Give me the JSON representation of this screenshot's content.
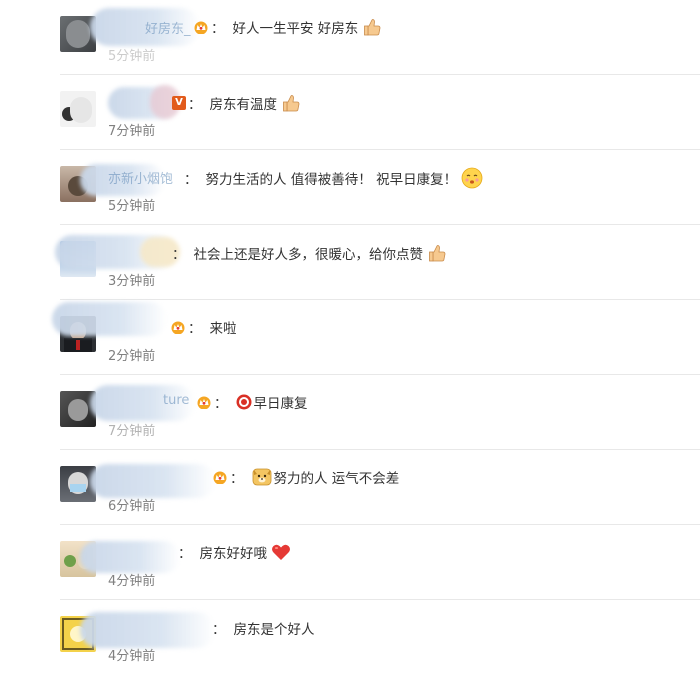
{
  "comments": [
    {
      "name_peek": "好房东_",
      "text": "好人一生平安 好房东",
      "time": "5分钟前",
      "emoji": "thumbs-up-icon",
      "crown": true
    },
    {
      "name_peek": "",
      "text": "房东有温度",
      "time": "7分钟前",
      "emoji": "thumbs-up-icon",
      "crown": false,
      "v_badge": "V"
    },
    {
      "name_peek": "亦新小烟饱",
      "text": "努力生活的人 值得被善待！ 祝早日康复！",
      "time": "5分钟前",
      "emoji": "kiss-face-icon",
      "crown": false
    },
    {
      "name_peek": "",
      "text": "社会上还是好人多，很暖心，给你点赞",
      "time": "3分钟前",
      "emoji": "thumbs-up-icon",
      "crown": false
    },
    {
      "name_peek": "",
      "text": "来啦",
      "time": "2分钟前",
      "emoji": "",
      "crown": true
    },
    {
      "name_peek": "ture",
      "text": "早日康复",
      "time": "7分钟前",
      "emoji": "",
      "crown": true,
      "prefix_emoji": "red-badge-icon"
    },
    {
      "name_peek": "",
      "text": "努力的人 运气不会差",
      "time": "6分钟前",
      "emoji": "",
      "crown": true,
      "prefix_emoji": "doge-icon"
    },
    {
      "name_peek": "",
      "text": "房东好好哦",
      "time": "4分钟前",
      "emoji": "heart-icon",
      "crown": false
    },
    {
      "name_peek": "",
      "text": "房东是个好人",
      "time": "4分钟前",
      "emoji": "",
      "crown": false
    }
  ],
  "colors": {
    "name": "#5d88b5",
    "time": "#808080",
    "divider": "#e8e8e8",
    "crown": "#f5a623",
    "heart": "#e53935"
  }
}
